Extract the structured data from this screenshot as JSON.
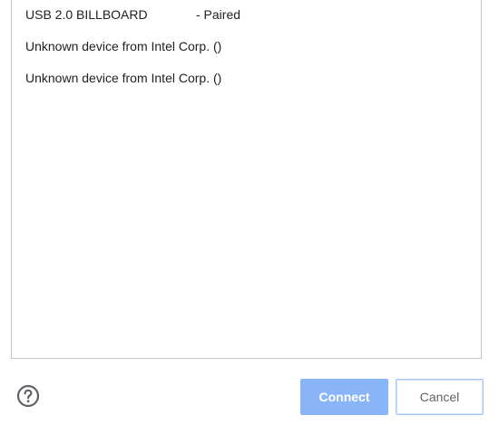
{
  "devices": [
    {
      "name": "USB 2.0 BILLBOARD",
      "status": "- Paired"
    },
    {
      "name": "Unknown device from Intel Corp. ()",
      "status": ""
    },
    {
      "name": "Unknown device from Intel Corp. ()",
      "status": ""
    }
  ],
  "footer": {
    "help_icon": "question-circle-icon",
    "connect_label": "Connect",
    "cancel_label": "Cancel"
  },
  "colors": {
    "connect_bg": "#8ab4f8",
    "cancel_border": "#a8c7fa",
    "text": "#202124",
    "help_icon": "#5f6368"
  }
}
